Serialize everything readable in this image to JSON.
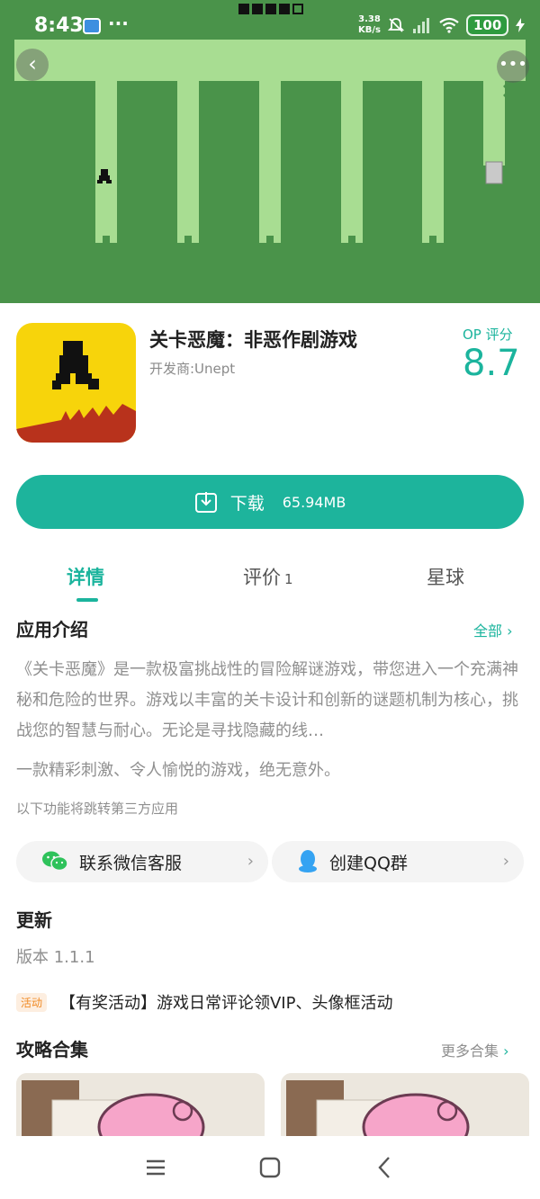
{
  "status_bar": {
    "time": "8:43",
    "speed_value": "3.38",
    "speed_unit": "KB/s",
    "battery": "100"
  },
  "hero": {
    "back_icon": "chevron-left-icon",
    "more_icon": "more-dots-icon"
  },
  "app": {
    "title": "关卡恶魔：非恶作剧游戏",
    "developer": "开发商:Unept",
    "score_label": "OP 评分",
    "score": "8.7"
  },
  "download": {
    "label": "下载",
    "size": "65.94MB"
  },
  "tabs": [
    {
      "label": "详情",
      "active": true
    },
    {
      "label": "评价",
      "count": "1"
    },
    {
      "label": "星球"
    }
  ],
  "intro": {
    "title": "应用介绍",
    "all_link": "全部",
    "description": "《关卡恶魔》是一款极富挑战性的冒险解谜游戏，带您进入一个充满神秘和危险的世界。游戏以丰富的关卡设计和创新的谜题机制为核心，挑战您的智慧与耐心。无论是寻找隐藏的线…",
    "tagline": "一款精彩刺激、令人愉悦的游戏，绝无意外。",
    "third_party_note": "以下功能将跳转第三方应用"
  },
  "actions": {
    "wechat_label": "联系微信客服",
    "qq_label": "创建QQ群"
  },
  "update": {
    "title": "更新",
    "version": "版本 1.1.1",
    "promo_tag": "活动",
    "promo_text": "【有奖活动】游戏日常评论领VIP、头像框活动"
  },
  "guides": {
    "title": "攻略合集",
    "more_link": "更多合集"
  },
  "colors": {
    "accent": "#1bb49d",
    "hero_bg": "#4a934a",
    "hero_fg": "#a8dd92",
    "promo": "#f08a24"
  }
}
